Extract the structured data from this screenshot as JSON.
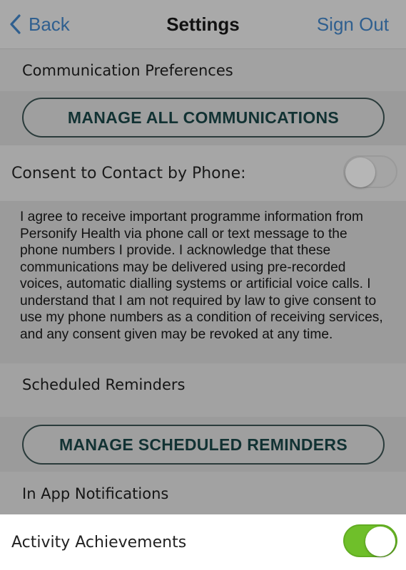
{
  "nav": {
    "back_label": "Back",
    "title": "Settings",
    "sign_out_label": "Sign Out"
  },
  "sections": {
    "communication": {
      "header": "Communication Preferences",
      "button_label": "MANAGE ALL COMMUNICATIONS"
    },
    "consent": {
      "label": "Consent to Contact by Phone:",
      "toggle_state": "off",
      "text": "I agree to receive important programme information from Personify Health via phone call or text message to the phone numbers I provide. I acknowledge that these communications may be delivered using pre-recorded voices, automatic dialling systems or artificial voice calls. I understand that I am not required by law to give consent to use my phone numbers as a condition of receiving services, and any consent given may be revoked at any time."
    },
    "reminders": {
      "header": "Scheduled Reminders",
      "button_label": "MANAGE SCHEDULED REMINDERS"
    },
    "notifications": {
      "header": "In App Notifications",
      "items": [
        {
          "label": "Activity Achievements",
          "toggle_state": "on"
        }
      ]
    }
  },
  "colors": {
    "link": "#2f5f8f",
    "toggle_on": "#6fbf2a",
    "button_text": "#123233"
  },
  "icons": {
    "back": "chevron-left-icon"
  }
}
